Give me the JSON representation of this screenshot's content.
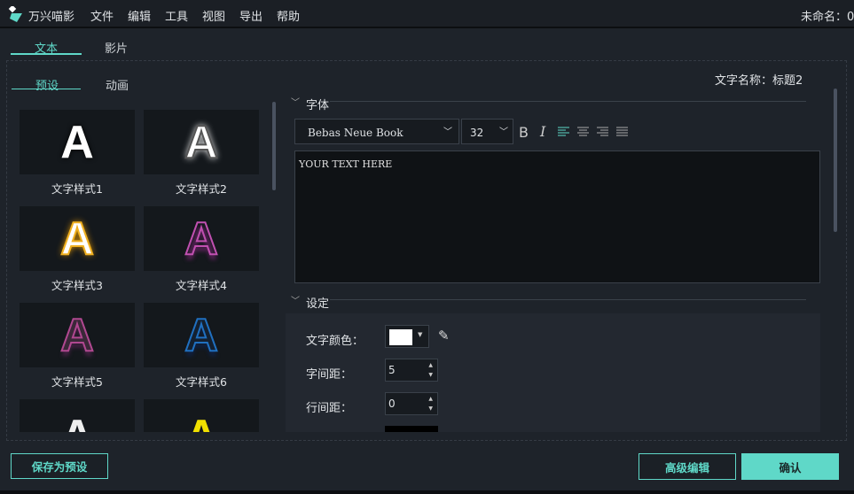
{
  "app": {
    "name": "万兴喵影",
    "menu": [
      "文件",
      "编辑",
      "工具",
      "视图",
      "导出",
      "帮助"
    ],
    "doc_title": "未命名：0"
  },
  "tabs": [
    "文本",
    "影片"
  ],
  "subtabs": [
    "预设",
    "动画"
  ],
  "styles": [
    {
      "label": "文字样式1"
    },
    {
      "label": "文字样式2"
    },
    {
      "label": "文字样式3"
    },
    {
      "label": "文字样式4"
    },
    {
      "label": "文字样式5"
    },
    {
      "label": "文字样式6"
    },
    {
      "label": ""
    },
    {
      "label": ""
    }
  ],
  "thumb_glyph": "A",
  "text_name": "文字名称：标题2",
  "font_section": {
    "title": "字体",
    "font": "Bebas Neue Book",
    "size": "32",
    "bold": "B",
    "italic": "I",
    "text": "YOUR TEXT HERE"
  },
  "settings": {
    "title": "设定",
    "color_label": "文字颜色：",
    "color": "#ffffff",
    "spacing_label": "字间距：",
    "spacing": "5",
    "line_label": "行间距：",
    "line": "0"
  },
  "footer": {
    "save_preset": "保存为预设",
    "advanced": "高级编辑",
    "confirm": "确认"
  },
  "accent": "#5fd8c8"
}
